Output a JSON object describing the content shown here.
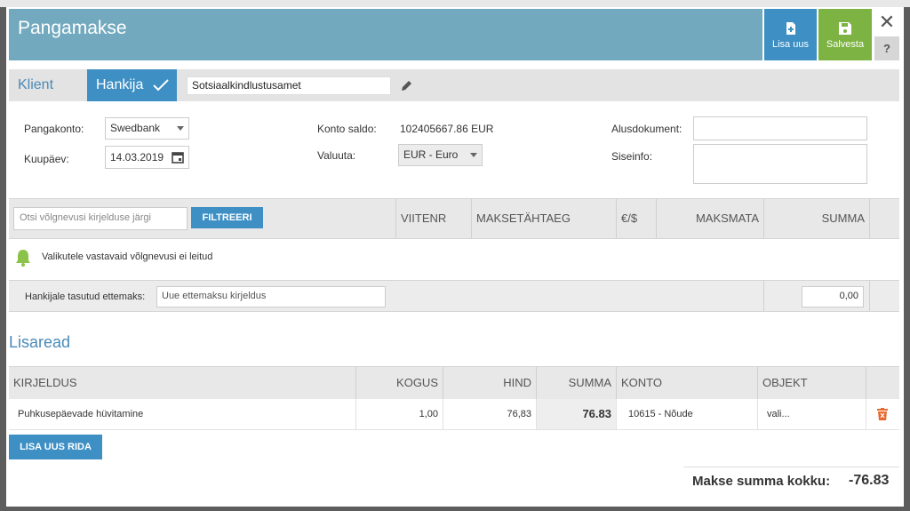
{
  "modal": {
    "title": "Pangamakse",
    "btn_new": "Lisa uus",
    "btn_save": "Salvesta",
    "close_symbol": "✕",
    "help_symbol": "?"
  },
  "type": {
    "klient": "Klient",
    "hankija": "Hankija",
    "partner_value": "Sotsiaalkindlustusamet"
  },
  "form": {
    "bank_label": "Pangakonto:",
    "bank_value": "Swedbank",
    "date_label": "Kuupäev:",
    "date_value": "14.03.2019",
    "balance_label": "Konto saldo:",
    "balance_value": "102405667.86 EUR",
    "currency_label": "Valuuta:",
    "currency_value": "EUR - Euro",
    "doc_label": "Alusdokument:",
    "info_label": "Siseinfo:"
  },
  "debts": {
    "search_placeholder": "Otsi võlgnevusi kirjelduse järgi",
    "filter_btn": "FILTREERI",
    "col_ref": "VIITENR",
    "col_due": "MAKSETÄHTAEG",
    "col_cur": "€/$",
    "col_unpaid": "MAKSMATA",
    "col_sum": "SUMMA",
    "empty_msg": "Valikutele vastavaid võlgnevusi ei leitud"
  },
  "advance": {
    "label": "Hankijale tasutud ettemaks:",
    "desc_placeholder": "Uue ettemaksu kirjeldus",
    "amount": "0,00"
  },
  "extra": {
    "title": "Lisaread",
    "col_desc": "KIRJELDUS",
    "col_qty": "KOGUS",
    "col_price": "HIND",
    "col_sum": "SUMMA",
    "col_account": "KONTO",
    "col_object": "OBJEKT",
    "rows": [
      {
        "desc": "Puhkusepäevade hüvitamine",
        "qty": "1,00",
        "price": "76,83",
        "sum": "76.83",
        "account": "10615 - Nõude",
        "object": "vali..."
      }
    ],
    "add_row_btn": "LISA UUS RIDA"
  },
  "total": {
    "label": "Makse summa kokku:",
    "value": "-76.83"
  },
  "colors": {
    "header": "#72a9be",
    "primary": "#3d8fc4",
    "save": "#7cb342",
    "delete": "#e8692e",
    "bell": "#8bc34a"
  }
}
